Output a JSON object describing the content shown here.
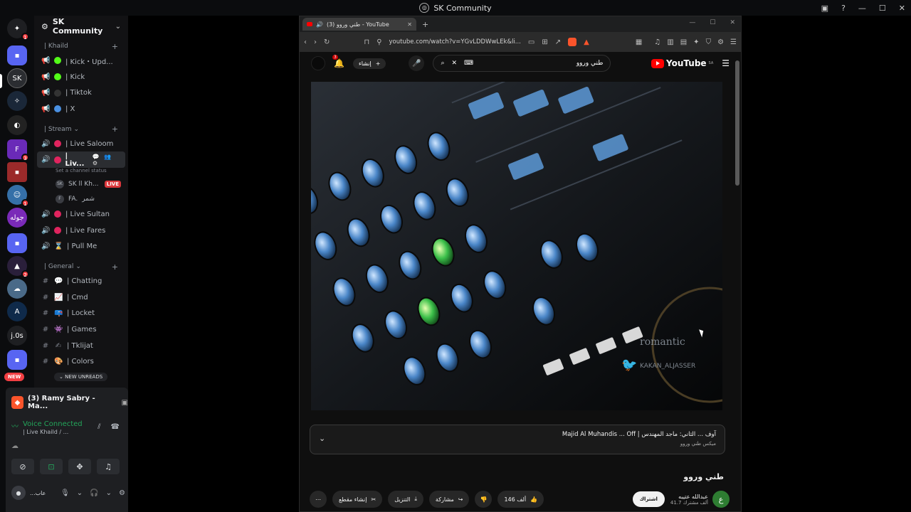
{
  "titlebar": {
    "title": "SK Community"
  },
  "rail": {
    "badges": {
      "home": "1",
      "s3": "3",
      "s6": "1",
      "s9": "2"
    },
    "labels": {
      "j0s": "j.0s",
      "jowla": "جوله"
    },
    "new_label": "NEW"
  },
  "sidebar": {
    "guild_name": "SK Community",
    "categories": {
      "khaild": "| Khaild",
      "stream": "| Stream",
      "general": "| General"
    },
    "khaild_channels": [
      "| Kick・Upd...",
      "| Kick",
      "| Tiktok",
      "| X"
    ],
    "stream_channels": {
      "live_saloom": "| Live Saloom",
      "live_active": "| Liv...",
      "status_note": "Set a channel status",
      "user1": "SK ll Kh...",
      "live_badge": "LIVE",
      "user2": "FA.",
      "user2_extra": "شمر",
      "live_sultan": "| Live Sultan",
      "live_fares": "| Live Fares",
      "pull_me": "| Pull Me"
    },
    "general_channels": [
      "| Chatting",
      "| Cmd",
      "| Locket",
      "| Games",
      "| Tklijat",
      "| Colors"
    ],
    "new_unreads": "NEW UNREADS"
  },
  "panel": {
    "stream_title": "(3) Ramy Sabry - Ma...",
    "voice_connected": "Voice Connected",
    "voice_channel": "| Live Khaild / ...",
    "user_name": "...عاب"
  },
  "browser": {
    "tab_title": "(3) طني وروو - YouTube",
    "url": "youtube.com/watch?v=YGvLDDWwLEk&li...",
    "bell_count": "3",
    "create_label": "إنشاء",
    "search_query": "طني وروو",
    "logo_text": "YouTube",
    "logo_country": "SA"
  },
  "video": {
    "chapter_title": "Majid Al Muhandis ... Off | آوف ... الثاني: ماجد المهندس",
    "chapter_sub": "ميكس طني وروو",
    "title": "طني وروو",
    "channel_name": "عبدالله عتيبه",
    "subs": "41.7 ألف مشترك",
    "subscribe": "اشتراك",
    "likes": "146 ألف",
    "share": "مشاركة",
    "download": "التنزيل",
    "clip": "إنشاء مقطع",
    "watermark1": "romantic",
    "watermark2": "KAKAN_ALJASSER"
  },
  "colors": {
    "discord_bg": "#121214",
    "accent_red": "#f23f43",
    "voice_green": "#23a55a",
    "youtube_red": "#ff0000"
  }
}
